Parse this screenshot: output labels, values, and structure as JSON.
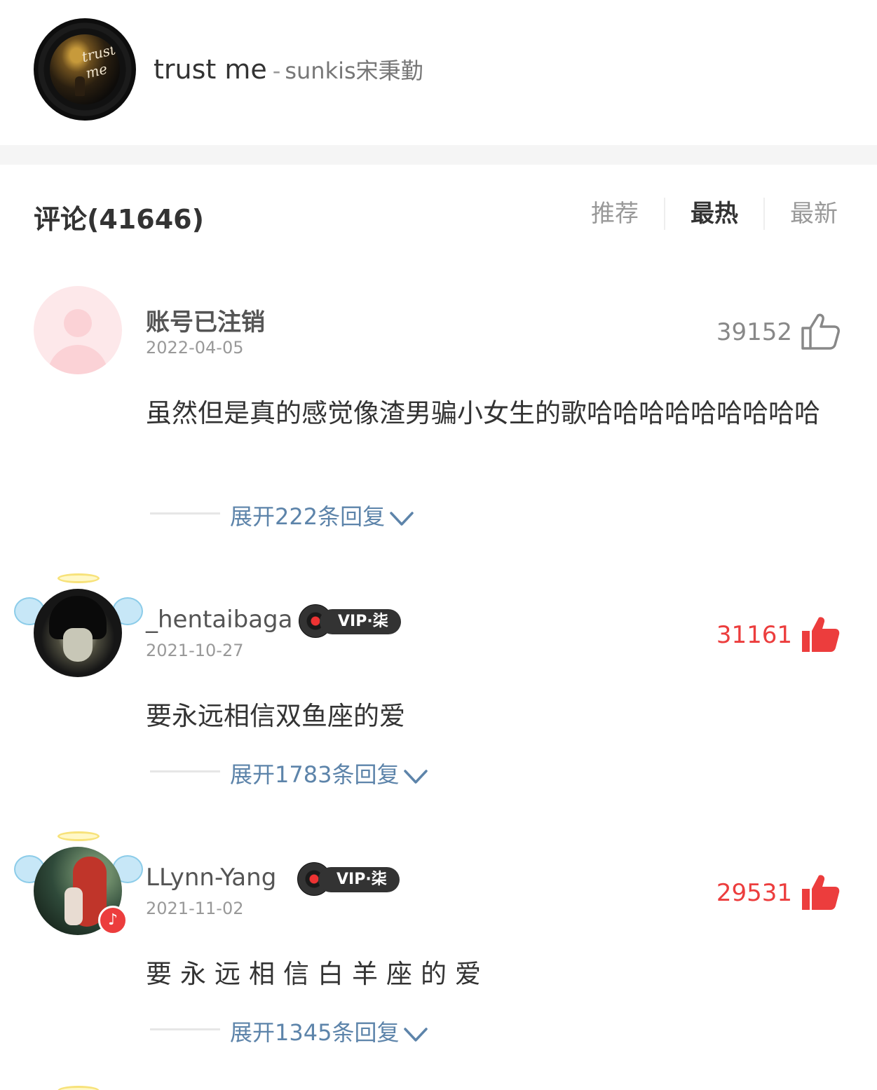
{
  "song": {
    "title": "trust me",
    "separator": "-",
    "artist": "sunkis宋秉勤",
    "album_art_text": "trust me"
  },
  "comments_header": {
    "title": "评论(41646)",
    "sort_tabs": [
      {
        "label": "推荐",
        "active": false
      },
      {
        "label": "最热",
        "active": true
      },
      {
        "label": "最新",
        "active": false
      }
    ]
  },
  "comments": [
    {
      "username": "账号已注销",
      "date": "2022-04-05",
      "likes": "39152",
      "liked": false,
      "text": "虽然但是真的感觉像渣男骗小女生的歌哈哈哈哈哈哈哈哈哈",
      "reply_label": "展开222条回复",
      "avatar_icon": "default-user-icon"
    },
    {
      "username": "_hentaibaga",
      "vip": "VIP·柒",
      "date": "2021-10-27",
      "likes": "31161",
      "liked": true,
      "text": "要永远相信双鱼座的爱",
      "reply_label": "展开1783条回复",
      "avatar_icon": "angel-frame-icon"
    },
    {
      "username": "LLynn-Yang",
      "vip": "VIP·柒",
      "date": "2021-11-02",
      "likes": "29531",
      "liked": true,
      "text": "要永远相信白羊座的爱",
      "reply_label": "展开1345条回复",
      "avatar_icon": "angel-frame-icon",
      "badge_icon": "music-note-icon"
    }
  ],
  "colors": {
    "accent_red": "#ec3d3d",
    "link_blue": "#5d84aa",
    "text_gray": "#999999"
  }
}
